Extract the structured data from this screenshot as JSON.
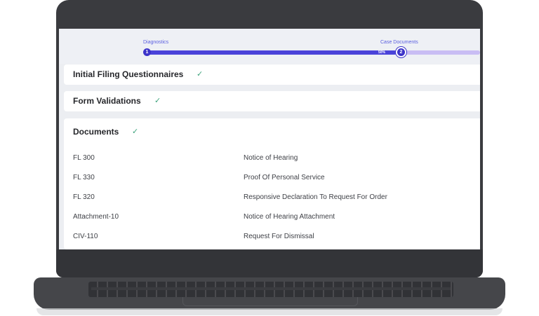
{
  "progress": {
    "steps": [
      {
        "label": "Diagnostics",
        "number": "1"
      },
      {
        "label": "Case Documents",
        "number": "2"
      }
    ],
    "percent_label": "50%",
    "progress_fraction": 0.75
  },
  "sections": {
    "initial_filing": {
      "title": "Initial Filing Questionnaires",
      "status_icon": "check-icon"
    },
    "form_validations": {
      "title": "Form Validations",
      "status_icon": "check-icon"
    },
    "documents": {
      "title": "Documents",
      "status_icon": "check-icon"
    }
  },
  "documents": [
    {
      "code": "FL 300",
      "name": "Notice of Hearing"
    },
    {
      "code": "FL 330",
      "name": "Proof Of Personal Service"
    },
    {
      "code": "FL 320",
      "name": "Responsive Declaration To Request For Order"
    },
    {
      "code": "Attachment-10",
      "name": "Notice of Hearing Attachment"
    },
    {
      "code": "CIV-110",
      "name": "Request For Dismissal"
    }
  ],
  "colors": {
    "accent": "#4a43d9",
    "track": "#c9bdf4",
    "check": "#3fa47d",
    "frame": "#3a3b3f"
  }
}
